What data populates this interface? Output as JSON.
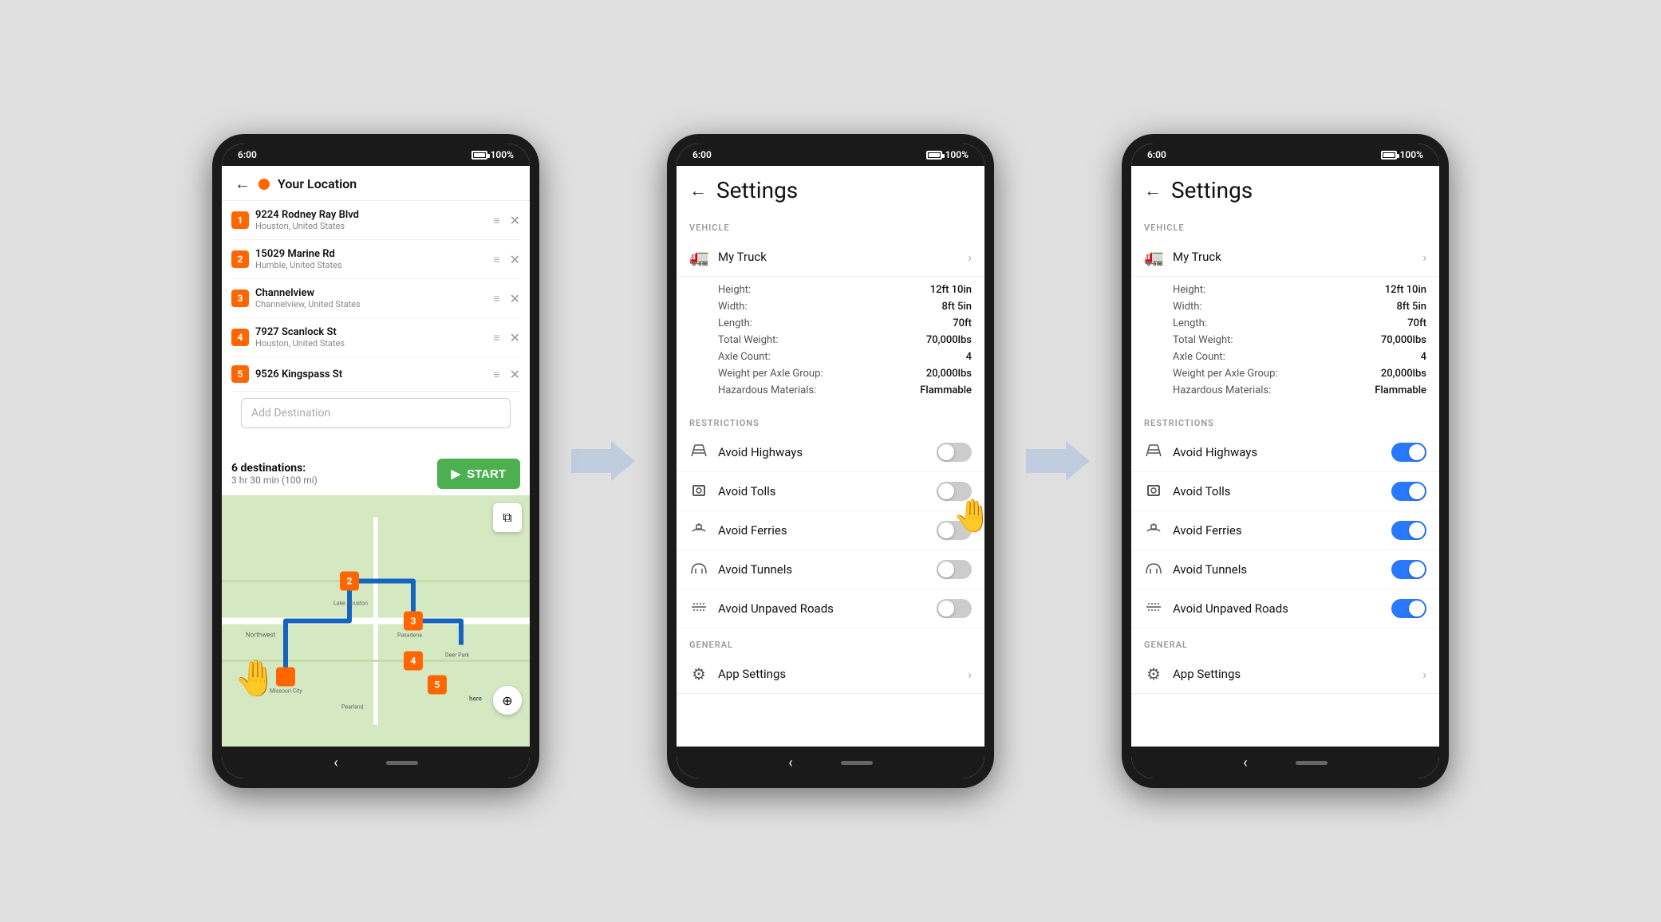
{
  "phone1": {
    "status": {
      "time": "6:00",
      "battery": "100%"
    },
    "header": {
      "back": "←",
      "location_dot": "orange",
      "location_label": "Your Location"
    },
    "destinations": [
      {
        "num": "1",
        "name": "9224 Rodney Ray Blvd",
        "sub": "Houston, United States"
      },
      {
        "num": "2",
        "name": "15029 Marine Rd",
        "sub": "Humble, United States"
      },
      {
        "num": "3",
        "name": "Channelview",
        "sub": "Channelview, United States"
      },
      {
        "num": "4",
        "name": "7927 Scanlock St",
        "sub": "Houston, United States"
      },
      {
        "num": "5",
        "name": "9526 Kingspass St",
        "sub": ""
      }
    ],
    "add_destination_placeholder": "Add Destination",
    "route_summary": {
      "destinations": "6 destinations:",
      "time_distance": "3 hr 30 min (100 mi)"
    },
    "start_button": "START"
  },
  "phone2": {
    "status": {
      "time": "6:00",
      "battery": "100%"
    },
    "header": {
      "back": "←",
      "title": "Settings"
    },
    "vehicle_section": "VEHICLE",
    "vehicle": {
      "icon": "🚛",
      "name": "My Truck",
      "height": "12ft 10in",
      "width": "8ft 5in",
      "length": "70ft",
      "total_weight": "70,000lbs",
      "axle_count": "4",
      "weight_per_axle": "20,000lbs",
      "hazardous": "Flammable",
      "labels": {
        "height": "Height:",
        "width": "Width:",
        "length": "Length:",
        "total_weight": "Total Weight:",
        "axle_count": "Axle Count:",
        "weight_per_axle": "Weight per Axle Group:",
        "hazardous": "Hazardous Materials:"
      }
    },
    "restrictions_section": "RESTRICTIONS",
    "restrictions": [
      {
        "icon": "🛣",
        "label": "Avoid Highways",
        "on": false
      },
      {
        "icon": "🚧",
        "label": "Avoid Tolls",
        "on": false
      },
      {
        "icon": "⛴",
        "label": "Avoid Ferries",
        "on": false
      },
      {
        "icon": "🚇",
        "label": "Avoid Tunnels",
        "on": false
      },
      {
        "icon": "🛤",
        "label": "Avoid Unpaved Roads",
        "on": false
      }
    ],
    "general_section": "GENERAL",
    "general": [
      {
        "icon": "⚙",
        "label": "App Settings"
      }
    ]
  },
  "phone3": {
    "status": {
      "time": "6:00",
      "battery": "100%"
    },
    "header": {
      "back": "←",
      "title": "Settings"
    },
    "vehicle_section": "VEHICLE",
    "vehicle": {
      "icon": "🚛",
      "name": "My Truck",
      "height": "12ft 10in",
      "width": "8ft 5in",
      "length": "70ft",
      "total_weight": "70,000lbs",
      "axle_count": "4",
      "weight_per_axle": "20,000lbs",
      "hazardous": "Flammable",
      "labels": {
        "height": "Height:",
        "width": "Width:",
        "length": "Length:",
        "total_weight": "Total Weight:",
        "axle_count": "Axle Count:",
        "weight_per_axle": "Weight per Axle Group:",
        "hazardous": "Hazardous Materials:"
      }
    },
    "restrictions_section": "RESTRICTIONS",
    "restrictions": [
      {
        "icon": "🛣",
        "label": "Avoid Highways",
        "on": true
      },
      {
        "icon": "🚧",
        "label": "Avoid Tolls",
        "on": true
      },
      {
        "icon": "⛴",
        "label": "Avoid Ferries",
        "on": true
      },
      {
        "icon": "🚇",
        "label": "Avoid Tunnels",
        "on": true
      },
      {
        "icon": "🛤",
        "label": "Avoid Unpaved Roads",
        "on": true
      }
    ],
    "general_section": "GENERAL",
    "general": [
      {
        "icon": "⚙",
        "label": "App Settings"
      }
    ]
  },
  "arrows": {
    "color": "#b0bec5"
  }
}
